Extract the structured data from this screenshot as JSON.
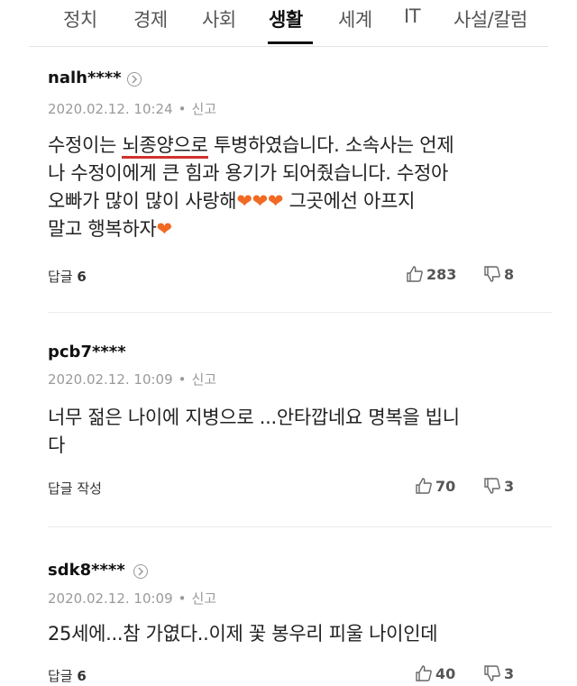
{
  "tabs": [
    {
      "label": "정치"
    },
    {
      "label": "경제"
    },
    {
      "label": "사회"
    },
    {
      "label": "생활"
    },
    {
      "label": "세계"
    },
    {
      "label": "IT"
    },
    {
      "label": "사설/칼럼"
    }
  ],
  "active_tab": "생활",
  "comments": [
    {
      "author": "nalh****",
      "date": "2020.02.12. 10:24",
      "report": "신고",
      "text_before": "수정이는 ",
      "text_highlight": "뇌종양으로",
      "text_line1_after": " 투병하였습니다. 소속사는 언제",
      "text_line2": "나 수정이에게 큰 힘과 용기가 되어줬습니다. 수정아",
      "text_line3a": "오빠가 많이 많이 사랑해",
      "hearts": "❤❤❤",
      "text_line3b": " 그곳에선 아프지",
      "text_line4": "말고 행복하자",
      "heart_end": "❤",
      "reply_label": "답글",
      "reply_count": "6",
      "likes": "283",
      "dislikes": "8"
    },
    {
      "author": "pcb7****",
      "date": "2020.02.12. 10:09",
      "report": "신고",
      "text_line1": "너무 젊은 나이에 지병으로 ...안타깝네요 명복을 빕니",
      "text_line2": "다",
      "reply_label": "답글 작성",
      "likes": "70",
      "dislikes": "3"
    },
    {
      "author": "sdk8****",
      "date": "2020.02.12. 10:09",
      "report": "신고",
      "text_line1": "25세에...참 가엾다..이제 꽃 봉우리 피울 나이인데",
      "reply_label": "답글",
      "reply_count": "6",
      "likes": "40",
      "dislikes": "3"
    }
  ],
  "colors": {
    "highlight_underline": "#d0312d",
    "heart": "#f16a23"
  },
  "icons": [
    "profile-chevron-icon",
    "thumbs-up-icon",
    "thumbs-down-icon"
  ]
}
